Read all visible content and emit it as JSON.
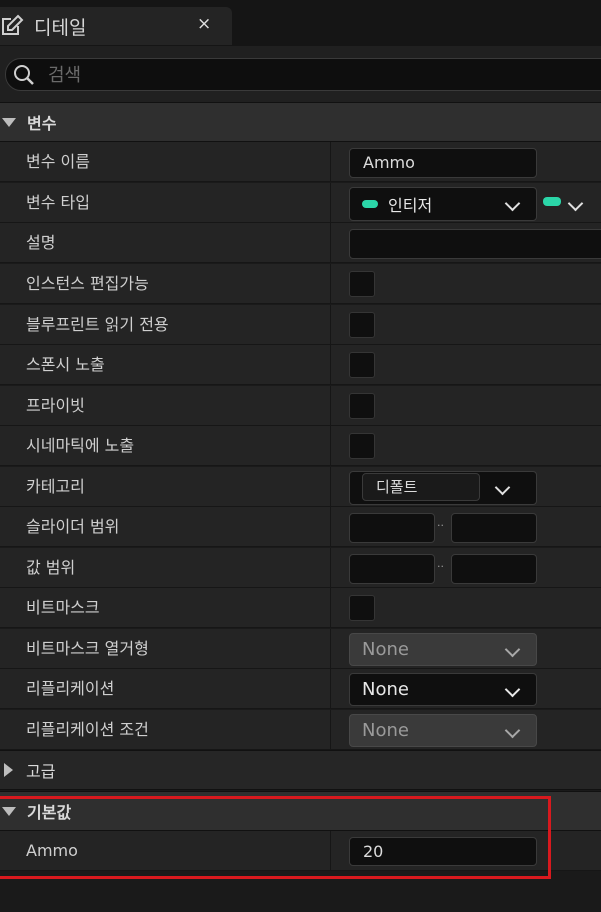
{
  "tab": {
    "title": "디테일",
    "close": "×"
  },
  "search": {
    "placeholder": "검색",
    "value": ""
  },
  "sections": {
    "variables": "변수",
    "advanced": "고급",
    "default_value": "기본값"
  },
  "rows": {
    "var_name": {
      "label": "변수 이름",
      "value": "Ammo"
    },
    "var_type": {
      "label": "변수 타입",
      "value": "인티저",
      "type_color": "#2bd6a8"
    },
    "description": {
      "label": "설명",
      "value": ""
    },
    "instance_editable": {
      "label": "인스턴스 편집가능"
    },
    "bp_readonly": {
      "label": "블루프린트 읽기 전용"
    },
    "expose_spawn": {
      "label": "스폰시 노출"
    },
    "private": {
      "label": "프라이빗"
    },
    "expose_cinematic": {
      "label": "시네마틱에 노출"
    },
    "category": {
      "label": "카테고리",
      "value": "디폴트"
    },
    "slider_range": {
      "label": "슬라이더 범위",
      "sep": "··"
    },
    "value_range": {
      "label": "값 범위",
      "sep": "··"
    },
    "bitmask": {
      "label": "비트마스크"
    },
    "bitmask_enum": {
      "label": "비트마스크 열거형",
      "value": "None"
    },
    "replication": {
      "label": "리플리케이션",
      "value": "None"
    },
    "replication_condition": {
      "label": "리플리케이션 조건",
      "value": "None"
    },
    "ammo_default": {
      "label": "Ammo",
      "value": "20"
    }
  },
  "colors": {
    "highlight": "#d8191e",
    "type_pin": "#2bd6a8"
  }
}
